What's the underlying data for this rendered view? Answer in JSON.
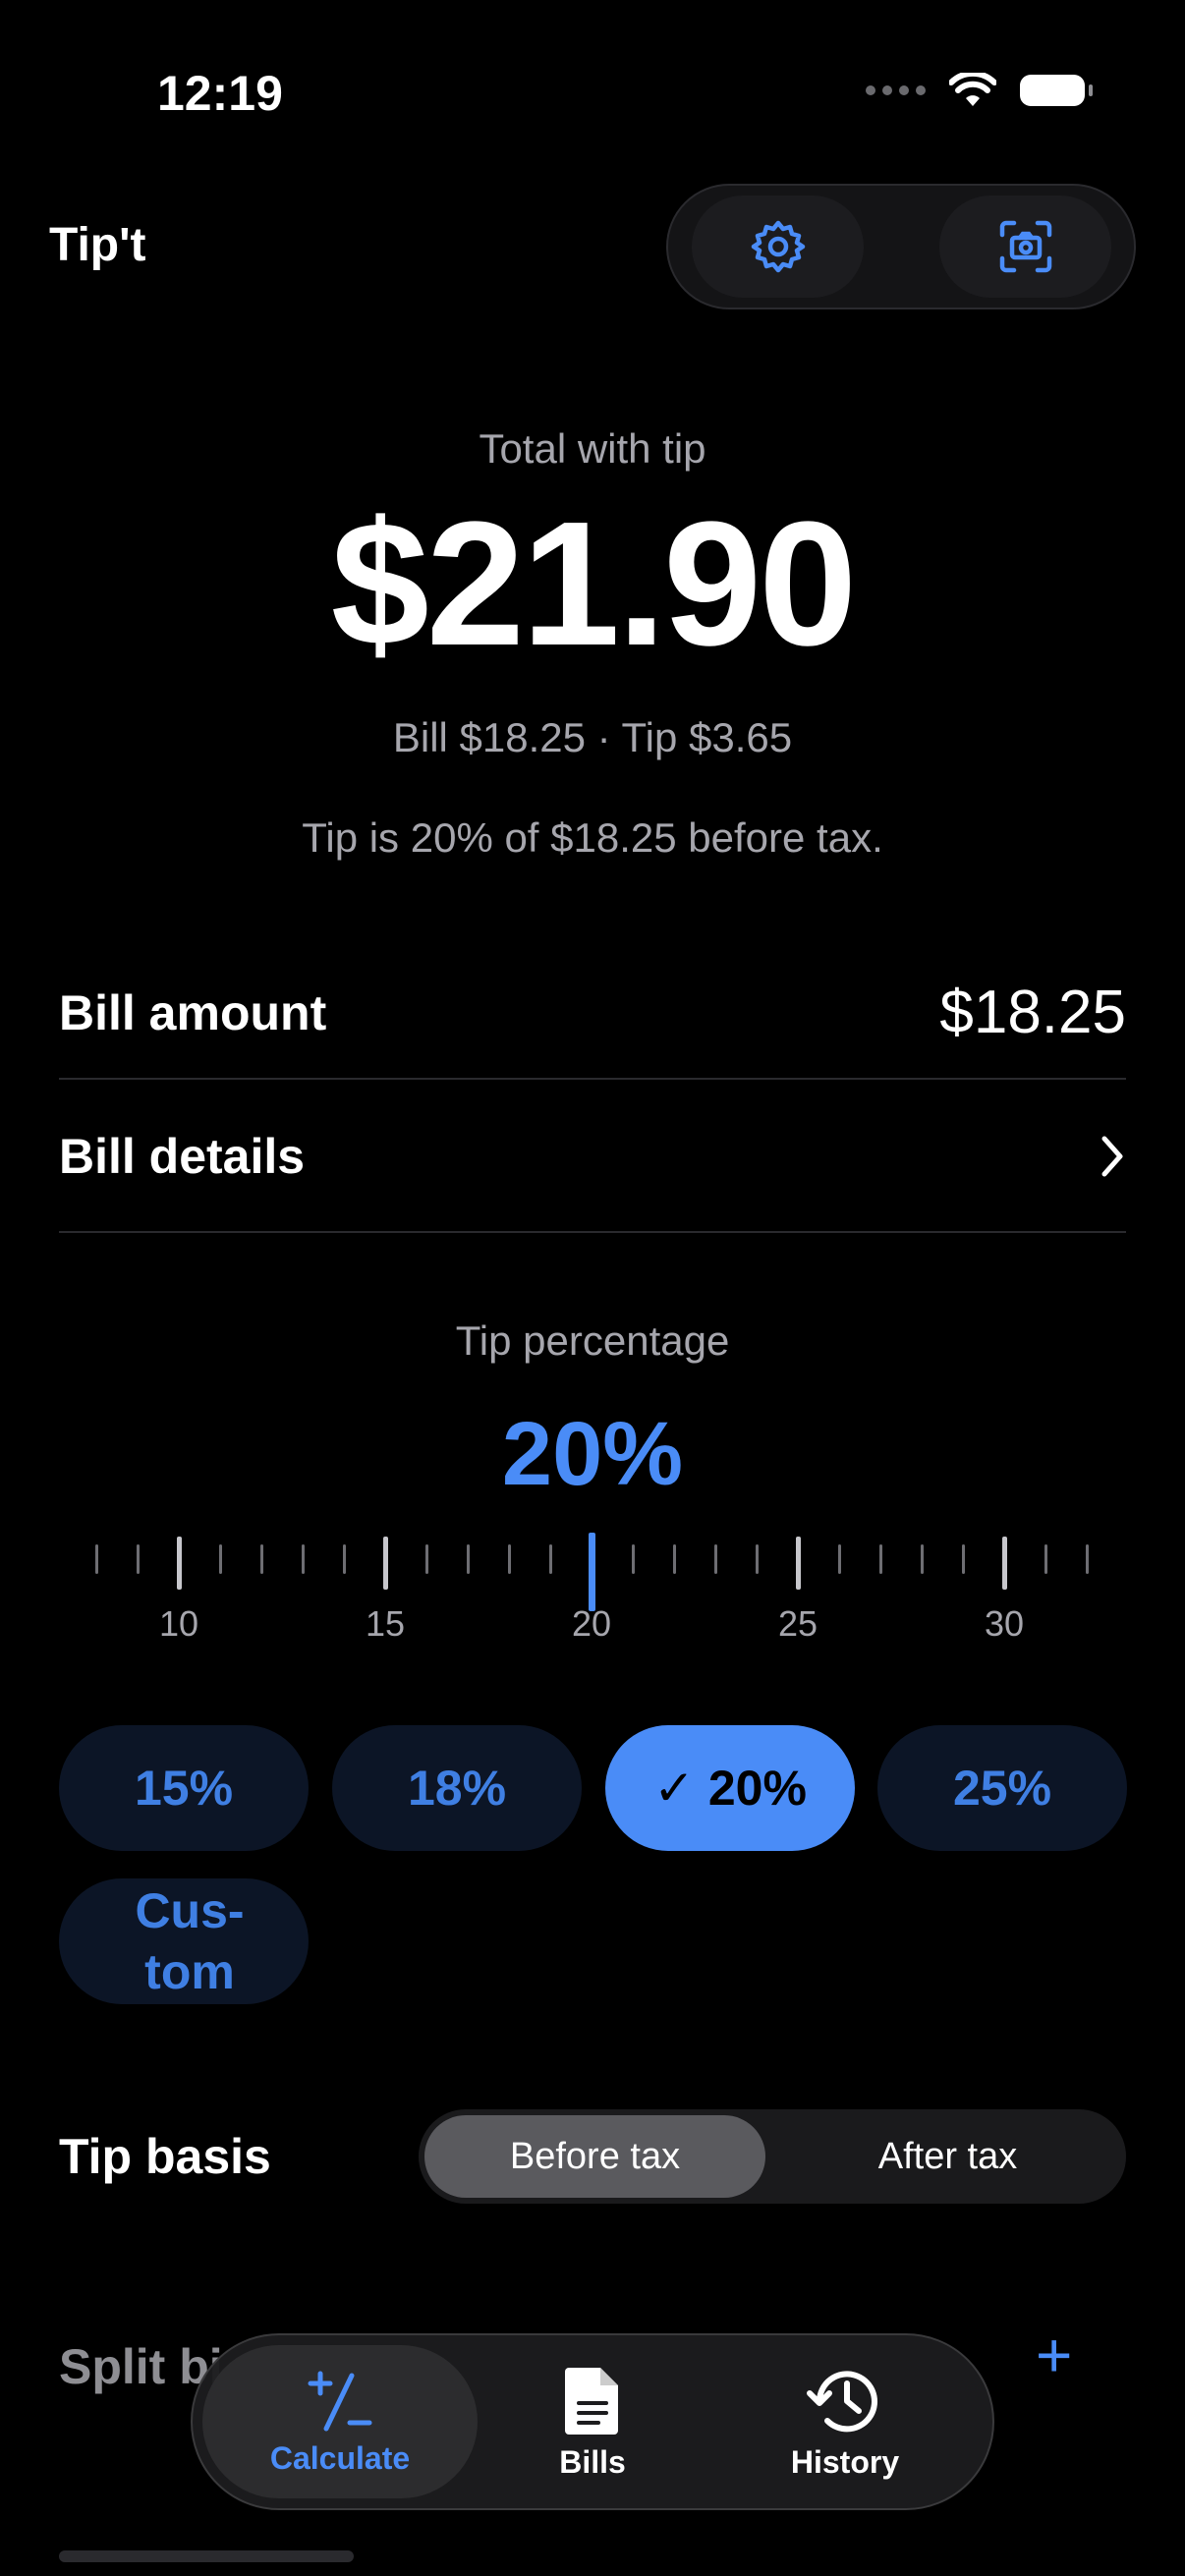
{
  "status_bar": {
    "time": "12:19"
  },
  "header": {
    "app_title": "Tip't",
    "settings_icon": "gear-icon",
    "scan_icon": "camera-scan-icon"
  },
  "summary": {
    "total_label": "Total with tip",
    "total_value": "$21.90",
    "breakdown": "Bill $18.25 · Tip $3.65",
    "tip_note": "Tip is 20% of $18.25 before tax."
  },
  "bill": {
    "amount_label": "Bill amount",
    "amount_value": "$18.25",
    "details_label": "Bill details"
  },
  "tip": {
    "label": "Tip percentage",
    "value": "20%",
    "ruler_labels": [
      "10",
      "15",
      "20",
      "25",
      "30"
    ],
    "ruler_value": 20,
    "presets": [
      "15%",
      "18%",
      "✓ 20%",
      "25%"
    ],
    "custom": [
      "Cus-",
      "tom"
    ]
  },
  "tip_basis": {
    "label": "Tip basis",
    "options": [
      "Before tax",
      "After tax"
    ],
    "selected": "Before tax"
  },
  "partial": {
    "split_label": "Split bi",
    "add_symbol": "+"
  },
  "tabbar": {
    "tabs": [
      {
        "label": "Calculate",
        "icon": "plus-minus-icon"
      },
      {
        "label": "Bills",
        "icon": "document-icon"
      },
      {
        "label": "History",
        "icon": "history-clock-icon"
      }
    ],
    "active": "Calculate"
  },
  "colors": {
    "accent": "#4a8cf7",
    "background": "#000000",
    "muted": "#a6a6ad"
  }
}
